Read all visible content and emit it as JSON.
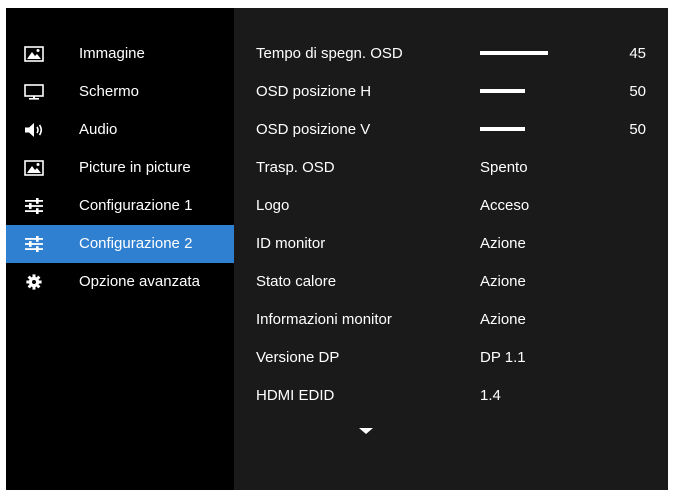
{
  "sidebar": {
    "items": [
      {
        "label": "Immagine",
        "icon": "picture-icon",
        "selected": false
      },
      {
        "label": "Schermo",
        "icon": "monitor-icon",
        "selected": false
      },
      {
        "label": "Audio",
        "icon": "speaker-icon",
        "selected": false
      },
      {
        "label": "Picture in picture",
        "icon": "picture-icon",
        "selected": false
      },
      {
        "label": "Configurazione 1",
        "icon": "sliders-icon",
        "selected": false
      },
      {
        "label": "Configurazione 2",
        "icon": "sliders-icon",
        "selected": true
      },
      {
        "label": "Opzione avanzata",
        "icon": "gear-icon",
        "selected": false
      }
    ]
  },
  "settings": {
    "rows": [
      {
        "label": "Tempo di spegn. OSD",
        "type": "slider",
        "value": 45,
        "max": 60
      },
      {
        "label": "OSD posizione H",
        "type": "slider",
        "value": 50,
        "max": 100
      },
      {
        "label": "OSD posizione V",
        "type": "slider",
        "value": 50,
        "max": 100
      },
      {
        "label": "Trasp. OSD",
        "type": "text",
        "value": "Spento"
      },
      {
        "label": "Logo",
        "type": "text",
        "value": "Acceso"
      },
      {
        "label": "ID monitor",
        "type": "text",
        "value": "Azione"
      },
      {
        "label": "Stato calore",
        "type": "text",
        "value": "Azione"
      },
      {
        "label": "Informazioni monitor",
        "type": "text",
        "value": "Azione"
      },
      {
        "label": "Versione DP",
        "type": "text",
        "value": "DP 1.1"
      },
      {
        "label": "HDMI EDID",
        "type": "text",
        "value": "1.4"
      }
    ]
  },
  "colors": {
    "sidebar_bg": "#000000",
    "panel_bg": "#1a1a1a",
    "selected": "#2f80d1",
    "text": "#ffffff"
  },
  "scroll_indicator": "chevron-down-icon"
}
